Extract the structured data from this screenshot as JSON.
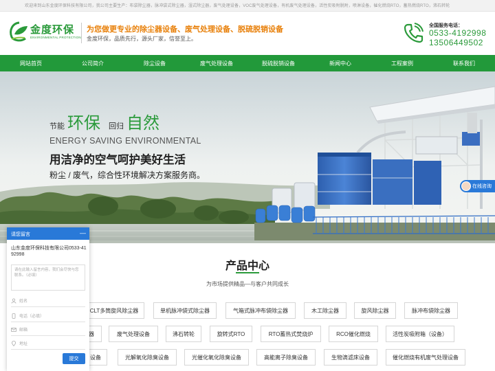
{
  "topbar": {
    "notice": "欢迎来到山东金度环保科技有限公司，我公司主要生产：布袋除尘器，脉冲袋式除尘器，湿式除尘器，废气处理设备，VOC废气处理设备，有机废气处理设备，活性炭吸附脱附，喷淋设备，催化燃烧RTO，蓄热燃烧RTO，沸石转轮"
  },
  "header": {
    "logo_name": "金度环保",
    "logo_sub": "ENVIRONMENTAL PROTECTION",
    "slogan": "为您做更专业的除尘器设备、废气处理设备、脱硫脱销设备",
    "subslogan": "金度环保，品质先行，源头厂家，信誉至上。",
    "hotline_label": "全国服务电话：",
    "phone1": "0533-4192998",
    "phone2": "13506449502"
  },
  "nav": {
    "items": [
      "网站首页",
      "公司简介",
      "除尘设备",
      "废气处理设备",
      "脱硫脱销设备",
      "新闻中心",
      "工程案例",
      "联系我们"
    ]
  },
  "banner": {
    "w1": "节能",
    "w2": "环保",
    "w3": "回归",
    "w4": "自然",
    "english": "ENERGY SAVING ENVIRONMENTAL",
    "title": "用洁净的空气呵护美好生活",
    "desc": "粉尘 / 废气，综合性环境解决方案服务商。",
    "online_label": "在线咨询"
  },
  "products": {
    "title": "产品中心",
    "subtitle": "为市场提供精品—与客户共同成长",
    "row1": [
      "CLT多筒旋风除尘器",
      "单机脉冲袋式除尘器",
      "气箱式脉冲布袋除尘器",
      "木工除尘器",
      "旋风除尘器",
      "脉冲布袋除尘器"
    ],
    "row2": [
      "器",
      "废气处理设备",
      "沸石转轮",
      "旋转式RTO",
      "RTO蓄热式焚烧炉",
      "RCO催化燃烧",
      "活性炭吸附箱（设备）"
    ],
    "row3": [
      "设备",
      "光解氧化除臭设备",
      "光催化氧化除臭设备",
      "高能离子除臭设备",
      "生物滴滤床设备",
      "催化燃烧有机废气处理设备"
    ]
  },
  "chat": {
    "header": "请您留言",
    "minimize": "—",
    "company": "山东金度环保科技有限公司0533-4192998",
    "textarea_placeholder": "请在此输入留言内容，我们会尽快与您联系。（必填）",
    "name_placeholder": "姓名",
    "phone_placeholder": "电话（必填）",
    "email_placeholder": "邮箱",
    "address_placeholder": "地址",
    "submit": "提交"
  },
  "colors": {
    "brand_green": "#22993a",
    "accent_orange": "#e8800a",
    "chat_blue": "#2979d8"
  }
}
